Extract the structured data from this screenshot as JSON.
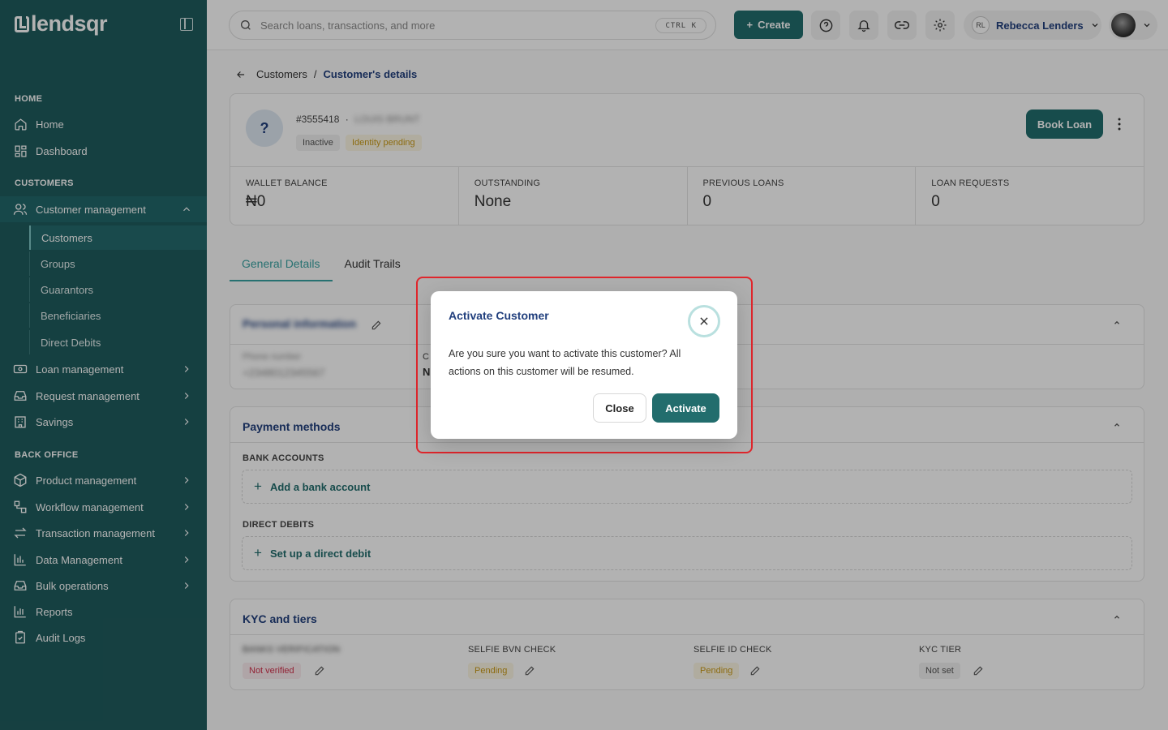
{
  "app": {
    "logo_text": "lendsqr"
  },
  "sidebar": {
    "sections": {
      "home": "HOME",
      "customers": "CUSTOMERS",
      "back_office": "BACK OFFICE"
    },
    "items": {
      "home": "Home",
      "dashboard": "Dashboard",
      "customer_management": "Customer management",
      "loan_management": "Loan management",
      "request_management": "Request management",
      "savings": "Savings",
      "product_management": "Product management",
      "workflow_management": "Workflow management",
      "transaction_management": "Transaction management",
      "data_management": "Data Management",
      "bulk_operations": "Bulk operations",
      "reports": "Reports",
      "audit_logs": "Audit Logs"
    },
    "sub_items": {
      "customers": "Customers",
      "groups": "Groups",
      "guarantors": "Guarantors",
      "beneficiaries": "Beneficiaries",
      "direct_debits": "Direct Debits"
    }
  },
  "header": {
    "search_placeholder": "Search loans, transactions, and more",
    "shortcut": "CTRL K",
    "create_label": "Create",
    "user_initials": "RL",
    "user_name": "Rebecca Lenders"
  },
  "breadcrumb": {
    "parent": "Customers",
    "separator": "/",
    "current": "Customer's details"
  },
  "profile": {
    "avatar_text": "?",
    "customer_id": "#3555418",
    "id_separator": "·",
    "blurred_name": "LOUIS BRUNT",
    "status_badge": "Inactive",
    "identity_badge": "Identity pending",
    "book_loan_label": "Book Loan",
    "stats": [
      {
        "label": "WALLET BALANCE",
        "value": "₦0"
      },
      {
        "label": "OUTSTANDING",
        "value": "None"
      },
      {
        "label": "PREVIOUS LOANS",
        "value": "0"
      },
      {
        "label": "LOAN REQUESTS",
        "value": "0"
      }
    ]
  },
  "tabs": {
    "general": "General Details",
    "audit": "Audit Trails"
  },
  "personal_info": {
    "title_blurred": "Personal information",
    "field_label_blurred": "Phone number",
    "field_value_blurred": "+2348012345567",
    "partial_label": "C",
    "partial_value": "N"
  },
  "payment_methods": {
    "title": "Payment methods",
    "bank_accounts_label": "BANK ACCOUNTS",
    "add_bank": "Add a bank account",
    "direct_debits_label": "DIRECT DEBITS",
    "add_debit": "Set up a direct debit"
  },
  "kyc": {
    "title": "KYC and tiers",
    "col1_label_blurred": "BANKS VERIFICATION",
    "col1_value": "Not verified",
    "col2_label": "SELFIE BVN CHECK",
    "col2_value": "Pending",
    "col3_label": "SELFIE ID CHECK",
    "col3_value": "Pending",
    "col4_label": "KYC TIER",
    "col4_value": "Not set"
  },
  "modal": {
    "title": "Activate Customer",
    "body": "Are you sure you want to activate this customer? All actions on this customer will be resumed.",
    "close_label": "Close",
    "activate_label": "Activate"
  },
  "colors": {
    "sidebar": "#1f5c5d",
    "primary": "#226d6d",
    "accent": "#39a3a2",
    "highlight": "#e0262c"
  }
}
